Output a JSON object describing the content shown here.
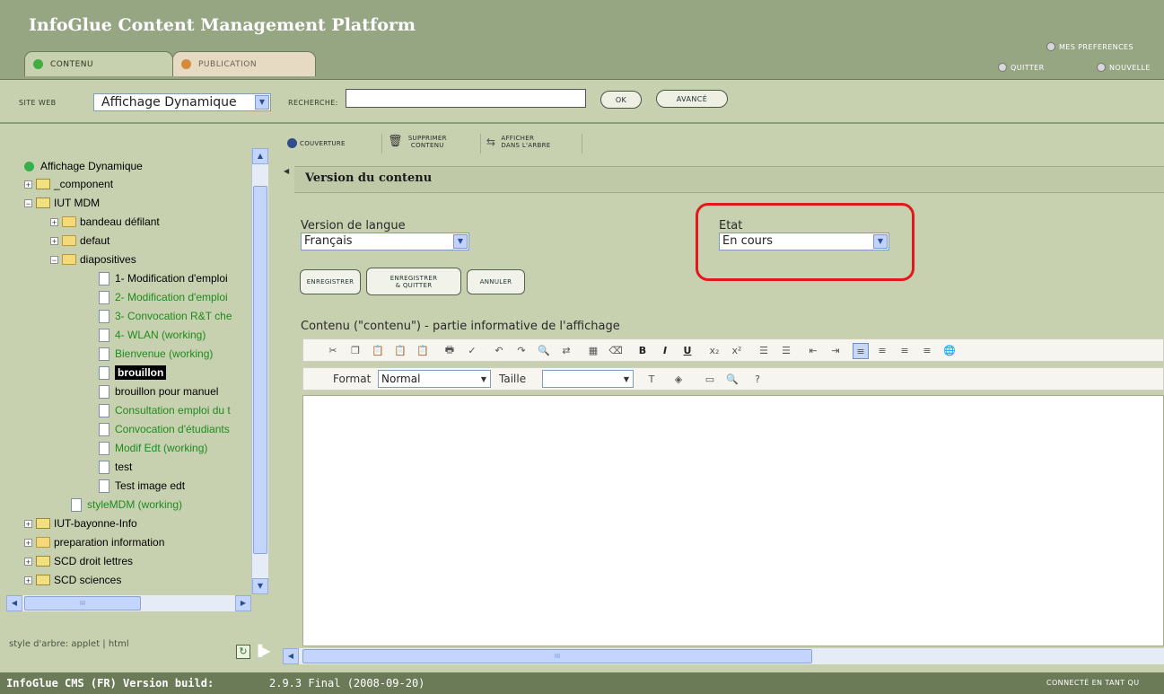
{
  "app": {
    "title": "InfoGlue Content Management Platform"
  },
  "tabs": [
    {
      "label": "CONTENU"
    },
    {
      "label": "PUBLICATION"
    }
  ],
  "toplinks": {
    "prefs": "MES PREFERENCES",
    "quit": "QUITTER",
    "new": "NOUVELLE"
  },
  "search": {
    "site_label": "SITE WEB",
    "site_value": "Affichage Dynamique",
    "search_label": "RECHERCHE:",
    "search_value": "",
    "ok_label": "OK",
    "advanced_label": "AVANCÉ"
  },
  "tree": {
    "root": "Affichage Dynamique",
    "items": [
      {
        "label": "_component"
      },
      {
        "label": "IUT MDM"
      },
      {
        "label": "bandeau défilant"
      },
      {
        "label": "defaut"
      },
      {
        "label": "diapositives"
      },
      {
        "label": "1- Modification d'emploi"
      },
      {
        "label": "2- Modification d'emploi"
      },
      {
        "label": "3- Convocation R&T che"
      },
      {
        "label": "4- WLAN (working)"
      },
      {
        "label": "Bienvenue (working)"
      },
      {
        "label": "brouillon"
      },
      {
        "label": "brouillon pour manuel"
      },
      {
        "label": "Consultation emploi du t"
      },
      {
        "label": "Convocation d'étudiants"
      },
      {
        "label": "Modif Edt (working)"
      },
      {
        "label": "test"
      },
      {
        "label": "Test image edt"
      },
      {
        "label": "styleMDM (working)"
      },
      {
        "label": "IUT-bayonne-Info"
      },
      {
        "label": "preparation information"
      },
      {
        "label": "SCD droit lettres"
      },
      {
        "label": "SCD sciences"
      }
    ],
    "style_label": "style d'arbre: applet | html",
    "hscroll_grip": "III"
  },
  "toolbar": {
    "cover": "COUVERTURE",
    "delete_l1": "SUPPRIMER",
    "delete_l2": "CONTENU",
    "show_l1": "AFFICHER",
    "show_l2": "DANS L'ARBRE"
  },
  "content": {
    "section_title": "Version du contenu",
    "language_label": "Version de langue",
    "language_value": "Français",
    "state_label": "Etat",
    "state_value": "En cours",
    "save": "ENREGISTRER",
    "save_quit_l1": "ENREGISTRER",
    "save_quit_l2": "& QUITTER",
    "cancel": "ANNULER",
    "editor_label": "Contenu (\"contenu\") - partie informative de l'affichage",
    "format_label": "Format",
    "format_value": "Normal",
    "size_label": "Taille",
    "size_value": "",
    "hscroll_grip": "III"
  },
  "footer": {
    "app_version_prefix": "InfoGlue CMS (FR) Version build:",
    "version": "2.9.3 Final (2008-09-20)",
    "connected": "CONNECTÉ EN TANT QU"
  }
}
